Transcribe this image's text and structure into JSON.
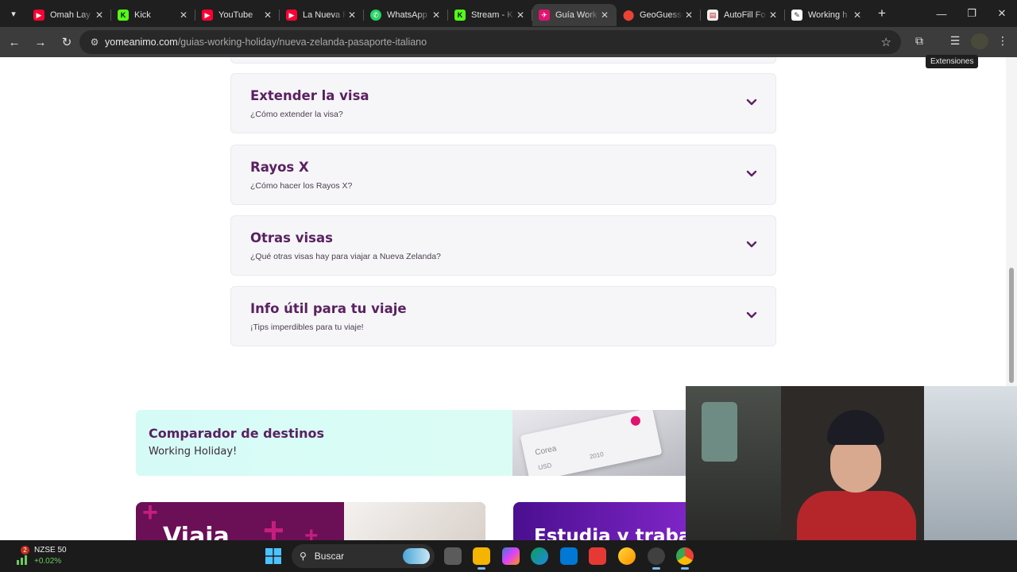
{
  "browser": {
    "tabs": [
      {
        "label": "Omah Lay",
        "favicon": "youtube-icon",
        "color": "#ff0033"
      },
      {
        "label": "Kick",
        "favicon": "kick-icon",
        "color": "#53fc18"
      },
      {
        "label": "YouTube",
        "favicon": "youtube-icon",
        "color": "#ff0033"
      },
      {
        "label": "La Nueva F",
        "favicon": "youtube-icon",
        "color": "#ff0033"
      },
      {
        "label": "WhatsApp",
        "favicon": "whatsapp-icon",
        "color": "#25d366"
      },
      {
        "label": "Stream - K",
        "favicon": "kick-icon",
        "color": "#53fc18"
      },
      {
        "label": "Guía Work",
        "favicon": "yomeanimo-icon",
        "color": "#e2136e",
        "active": true
      },
      {
        "label": "GeoGuessr",
        "favicon": "location-pin-icon",
        "color": "#d93025"
      },
      {
        "label": "AutoFill Fo",
        "favicon": "autofill-icon",
        "color": "#c5221f"
      },
      {
        "label": "Working h",
        "favicon": "pen-icon",
        "color": "#ffffff"
      }
    ],
    "url_host": "yomeanimo.com",
    "url_path": "/guias-working-holiday/nueva-zelanda-pasaporte-italiano",
    "tooltip": "Extensiones"
  },
  "accordion": [
    {
      "title": "Extender la visa",
      "subtitle": "¿Cómo extender la visa?"
    },
    {
      "title": "Rayos X",
      "subtitle": "¿Cómo hacer los Rayos X?"
    },
    {
      "title": "Otras visas",
      "subtitle": "¿Qué otras visas hay para viajar a Nueva Zelanda?"
    },
    {
      "title": "Info útil para tu viaje",
      "subtitle": "¡Tips imperdibles para tu viaje!"
    }
  ],
  "comparador": {
    "title": "Comparador de destinos",
    "subtitle": "Working Holiday!",
    "card_country": "Corea",
    "card_currency": "USD",
    "card_year": "2010"
  },
  "promos": {
    "left_text": "Viaja",
    "right_text": "Estudia y traba"
  },
  "taskbar": {
    "stock_badge": "2",
    "stock_name": "NZSE 50",
    "stock_change": "+0.02%",
    "search_label": "Buscar"
  },
  "colors": {
    "brand_purple": "#5a2160",
    "accordion_bg": "#f6f5f8",
    "browser_dark": "#1f1f1f",
    "toolbar": "#3c3c3c"
  }
}
